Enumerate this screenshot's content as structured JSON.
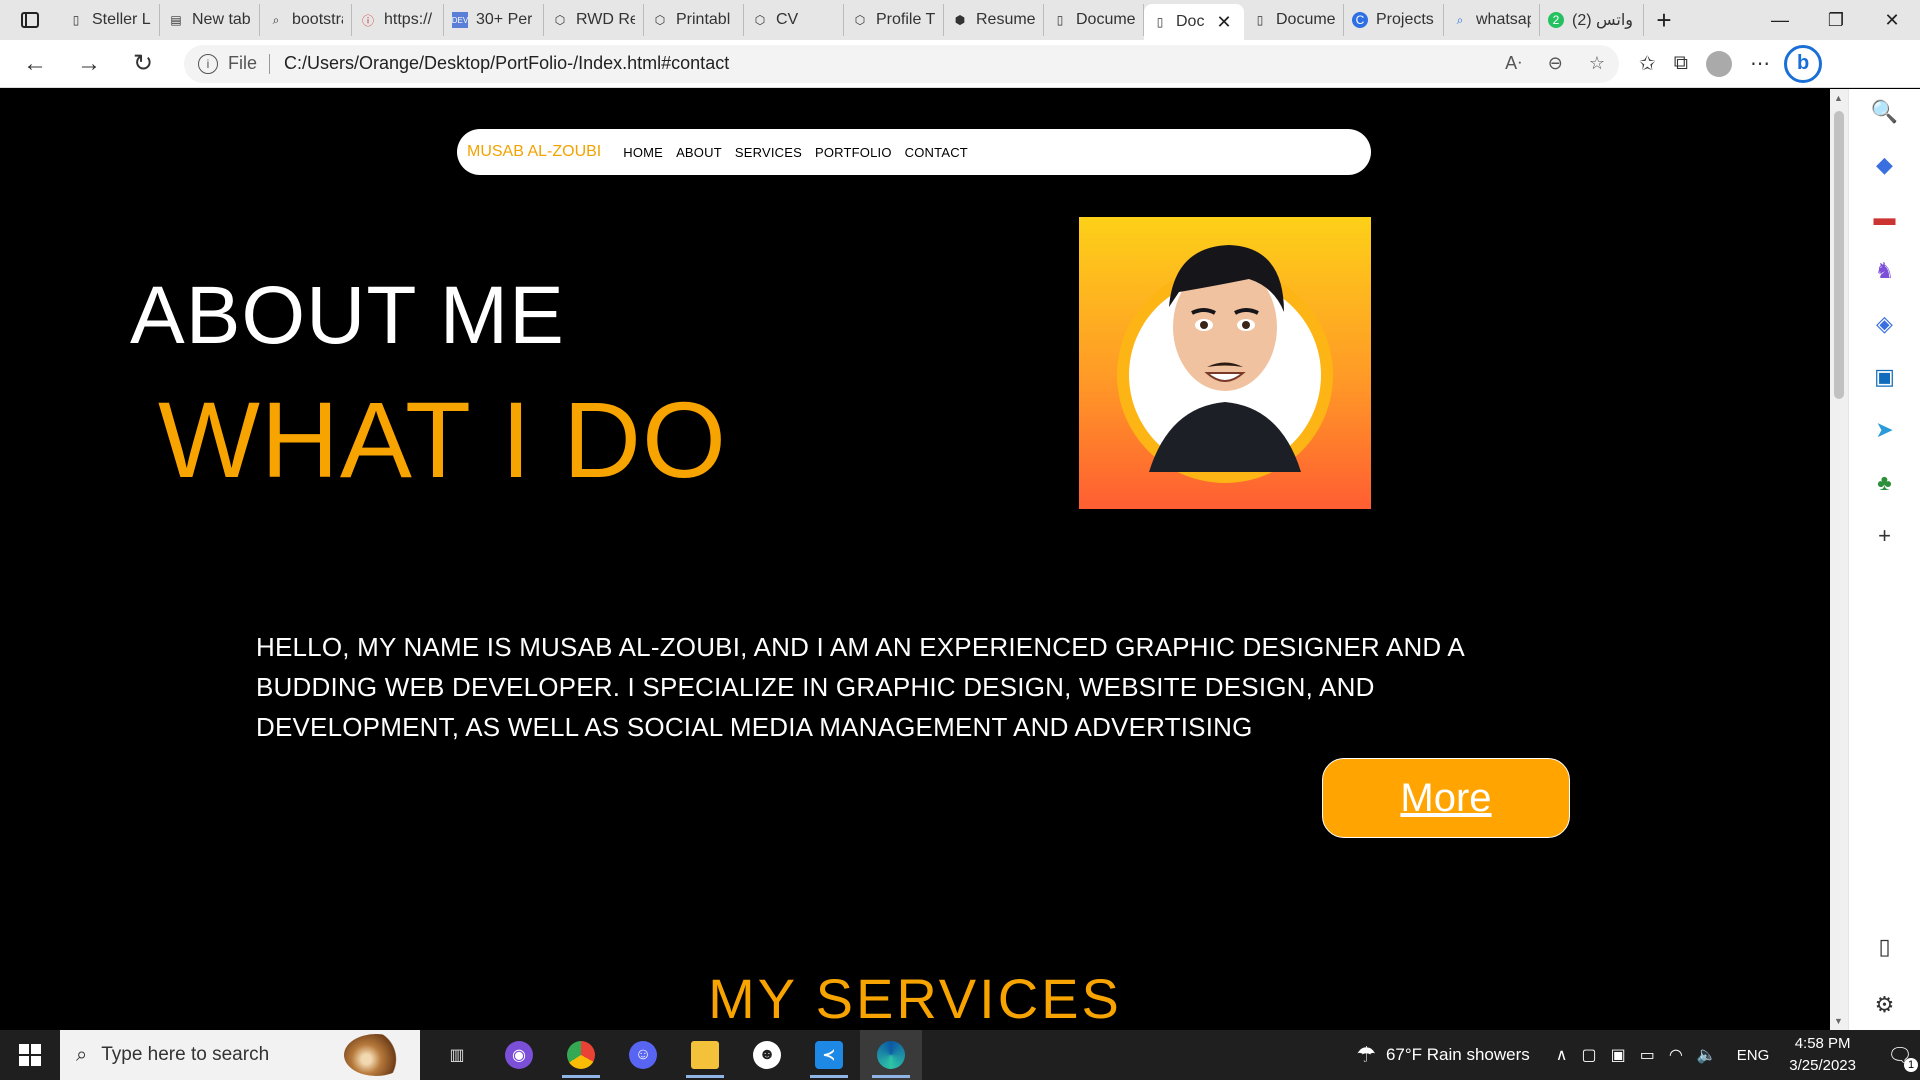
{
  "browser": {
    "tabs": [
      {
        "title": "Steller L",
        "icon": "page-icon",
        "active": false
      },
      {
        "title": "New tab",
        "icon": "newtab-icon",
        "active": false
      },
      {
        "title": "bootstra",
        "icon": "search-icon",
        "active": false
      },
      {
        "title": "https://",
        "icon": "error-icon",
        "active": false
      },
      {
        "title": "30+ Per",
        "icon": "dev-icon",
        "active": false
      },
      {
        "title": "RWD Re",
        "icon": "codepen-icon",
        "active": false
      },
      {
        "title": "Printabl",
        "icon": "codepen-icon",
        "active": false
      },
      {
        "title": "CV",
        "icon": "codepen-icon",
        "active": false
      },
      {
        "title": "Profile T",
        "icon": "codepen-icon",
        "active": false
      },
      {
        "title": "Resume",
        "icon": "codepen-icon",
        "active": false
      },
      {
        "title": "Docume",
        "icon": "page-icon",
        "active": false
      },
      {
        "title": "Doc",
        "icon": "page-icon",
        "active": true
      },
      {
        "title": "Docume",
        "icon": "page-icon",
        "active": false
      },
      {
        "title": "Projects",
        "icon": "copilot-icon",
        "active": false
      },
      {
        "title": "whatsap",
        "icon": "search-icon",
        "active": false
      },
      {
        "title": "(2) واتس",
        "icon": "whatsapp-icon",
        "active": false
      }
    ],
    "address": {
      "scheme": "File",
      "url": "C:/Users/Orange/Desktop/PortFolio-/Index.html#contact"
    }
  },
  "site": {
    "brand": "MUSAB AL-ZOUBI",
    "nav": [
      "HOME",
      "ABOUT",
      "SERVICES",
      "PORTFOLIO",
      "CONTACT"
    ],
    "hero_title": "ABOUT ME",
    "hero_subtitle": "WHAT I DO",
    "about_text": "HELLO, MY NAME IS MUSAB AL-ZOUBI, AND I AM AN EXPERIENCED GRAPHIC DESIGNER AND A BUDDING WEB DEVELOPER. I SPECIALIZE IN GRAPHIC DESIGN, WEBSITE DESIGN, AND DEVELOPMENT, AS WELL AS SOCIAL MEDIA MANAGEMENT AND ADVERTISING",
    "more_label": "More",
    "services_title": "MY SERVICES",
    "colors": {
      "accent": "#f7a300",
      "background": "#000000"
    }
  },
  "taskbar": {
    "search_placeholder": "Type here to search",
    "weather": "67°F  Rain showers",
    "language": "ENG",
    "time": "4:58 PM",
    "date": "3/25/2023",
    "notification_count": "1"
  }
}
